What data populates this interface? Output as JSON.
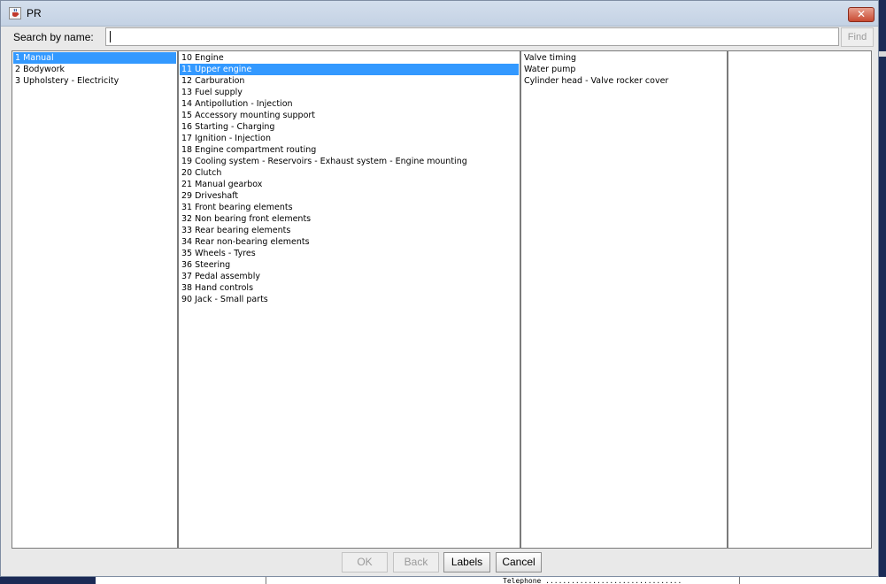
{
  "window": {
    "title": "PR",
    "close_glyph": "✕",
    "app_icon": "java-cup-icon"
  },
  "search": {
    "label": "Search by name:",
    "value": "",
    "find_label": "Find"
  },
  "columns": {
    "col1": {
      "items": [
        "1 Manual",
        "2 Bodywork",
        "3 Upholstery - Electricity"
      ],
      "selected_index": 0
    },
    "col2": {
      "items": [
        "10 Engine",
        "11 Upper engine",
        "12 Carburation",
        "13 Fuel supply",
        "14 Antipollution - Injection",
        "15 Accessory mounting support",
        "16 Starting - Charging",
        "17 Ignition - Injection",
        "18 Engine compartment routing",
        "19 Cooling system - Reservoirs - Exhaust system - Engine mounting",
        "20 Clutch",
        "21 Manual gearbox",
        "29 Driveshaft",
        "31 Front bearing elements",
        "32 Non bearing front elements",
        "33 Rear bearing elements",
        "34 Rear non-bearing elements",
        "35 Wheels - Tyres",
        "36 Steering",
        "37 Pedal assembly",
        "38 Hand controls",
        "90 Jack - Small parts"
      ],
      "selected_index": 1
    },
    "col3": {
      "items": [
        "Valve timing",
        "Water pump",
        "Cylinder head - Valve rocker cover"
      ],
      "selected_index": -1
    },
    "col4": {
      "items": [],
      "selected_index": -1
    }
  },
  "buttons": {
    "ok": "OK",
    "back": "Back",
    "labels": "Labels",
    "cancel": "Cancel"
  },
  "background": {
    "telephone_text": "Telephone ................................"
  },
  "colors": {
    "selection": "#3399ff",
    "close_button": "#c84a32",
    "background_navy": "#1b2a55"
  }
}
